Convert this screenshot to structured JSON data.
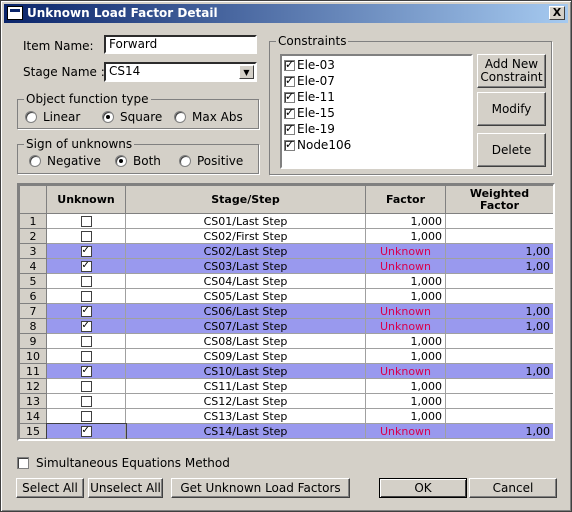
{
  "window": {
    "title": "Unknown Load Factor Detail",
    "close": "X"
  },
  "item_name": {
    "label": "Item Name:",
    "value": "Forward"
  },
  "stage_name": {
    "label": "Stage Name :",
    "value": "CS14"
  },
  "object_function": {
    "title": "Object function type",
    "options": [
      "Linear",
      "Square",
      "Max Abs"
    ],
    "selected": 1
  },
  "sign": {
    "title": "Sign of unknowns",
    "options": [
      "Negative",
      "Both",
      "Positive"
    ],
    "selected": 1
  },
  "constraints": {
    "title": "Constraints",
    "items": [
      {
        "label": "Ele-03",
        "checked": true
      },
      {
        "label": "Ele-07",
        "checked": true
      },
      {
        "label": "Ele-11",
        "checked": true
      },
      {
        "label": "Ele-15",
        "checked": true
      },
      {
        "label": "Ele-19",
        "checked": true
      },
      {
        "label": "Node106",
        "checked": true
      }
    ],
    "buttons": {
      "add_new_line1": "Add New",
      "add_new_line2": "Constraint",
      "modify": "Modify",
      "delete": "Delete"
    }
  },
  "table": {
    "headers": {
      "unknown": "Unknown",
      "stage_step": "Stage/Step",
      "factor": "Factor",
      "weighted_line1": "Weighted",
      "weighted_line2": "Factor"
    },
    "rows": [
      {
        "n": "1",
        "checked": false,
        "stage": "CS01/Last Step",
        "factor": "1,000",
        "weighted": ""
      },
      {
        "n": "2",
        "checked": false,
        "stage": "CS02/First Step",
        "factor": "1,000",
        "weighted": ""
      },
      {
        "n": "3",
        "checked": true,
        "stage": "CS02/Last Step",
        "factor": "Unknown",
        "weighted": "1,00"
      },
      {
        "n": "4",
        "checked": true,
        "stage": "CS03/Last Step",
        "factor": "Unknown",
        "weighted": "1,00"
      },
      {
        "n": "5",
        "checked": false,
        "stage": "CS04/Last Step",
        "factor": "1,000",
        "weighted": ""
      },
      {
        "n": "6",
        "checked": false,
        "stage": "CS05/Last Step",
        "factor": "1,000",
        "weighted": ""
      },
      {
        "n": "7",
        "checked": true,
        "stage": "CS06/Last Step",
        "factor": "Unknown",
        "weighted": "1,00"
      },
      {
        "n": "8",
        "checked": true,
        "stage": "CS07/Last Step",
        "factor": "Unknown",
        "weighted": "1,00"
      },
      {
        "n": "9",
        "checked": false,
        "stage": "CS08/Last Step",
        "factor": "1,000",
        "weighted": ""
      },
      {
        "n": "10",
        "checked": false,
        "stage": "CS09/Last Step",
        "factor": "1,000",
        "weighted": ""
      },
      {
        "n": "11",
        "checked": true,
        "stage": "CS10/Last Step",
        "factor": "Unknown",
        "weighted": "1,00"
      },
      {
        "n": "12",
        "checked": false,
        "stage": "CS11/Last Step",
        "factor": "1,000",
        "weighted": ""
      },
      {
        "n": "13",
        "checked": false,
        "stage": "CS12/Last Step",
        "factor": "1,000",
        "weighted": ""
      },
      {
        "n": "14",
        "checked": false,
        "stage": "CS13/Last Step",
        "factor": "1,000",
        "weighted": ""
      },
      {
        "n": "15",
        "checked": true,
        "stage": "CS14/Last Step",
        "factor": "Unknown",
        "weighted": "1,00"
      }
    ]
  },
  "simultaneous": {
    "label": "Simultaneous Equations Method",
    "checked": false
  },
  "buttons": {
    "select_all": "Select All",
    "unselect_all": "Unselect All",
    "get_unknown": "Get Unknown Load Factors",
    "ok": "OK",
    "cancel": "Cancel"
  },
  "colors": {
    "selected_row": "#9999ee",
    "unknown_text": "#d8004d",
    "title_bar": "#0a246a"
  }
}
